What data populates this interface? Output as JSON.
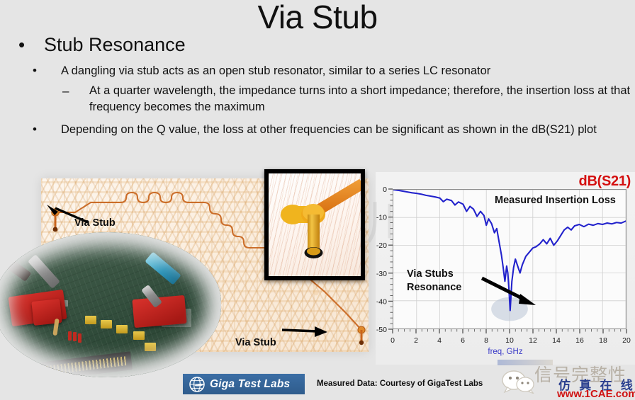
{
  "slide": {
    "title": "Via Stub",
    "background_color": "#e5e5e5"
  },
  "bullets": {
    "level1": "Stub Resonance",
    "level1_marker": "•",
    "items": [
      {
        "marker": "•",
        "level": 2,
        "text": "A dangling via stub acts as an open stub resonator, similar to a series LC resonator"
      },
      {
        "marker": "–",
        "level": 3,
        "text": "At a quarter wavelength, the impedance turns into a short impedance; therefore, the insertion loss at that frequency becomes the maximum"
      },
      {
        "marker": "•",
        "level": 2,
        "text": "Depending on the Q value, the loss at other frequencies can be significant as shown in the dB(S21) plot"
      }
    ]
  },
  "figures": {
    "pcb_callout_1": "Via Stub",
    "pcb_callout_2": "Via Stub",
    "via3d_caption": ""
  },
  "footer": {
    "logo_text": "Giga Test Labs",
    "logo_icon": "globe-icon",
    "courtesy": "Measured Data: Courtesy of GigaTest Labs"
  },
  "watermark": {
    "icon": "wechat-icon",
    "line1": "信号完整性",
    "line2": "仿 真 在 线",
    "url": "www.1CAE.com"
  },
  "chart_data": {
    "type": "line",
    "title": "dB(S21)",
    "title_color": "#d41010",
    "annotation": "Measured Insertion Loss",
    "callout": "Via Stubs\nResonance",
    "callout_line1": "Via Stubs",
    "callout_line2": "Resonance",
    "xlabel": "freq, GHz",
    "ylabel": "",
    "xlim": [
      0,
      20
    ],
    "ylim": [
      -50,
      0
    ],
    "xticks": [
      0,
      2,
      4,
      6,
      8,
      10,
      12,
      14,
      16,
      18,
      20
    ],
    "yticks": [
      0,
      -10,
      -20,
      -30,
      -40,
      -50
    ],
    "grid": true,
    "legend": "none",
    "series": [
      {
        "name": "dB(S21)",
        "color": "#2222cc",
        "x": [
          0.0,
          0.4,
          0.8,
          1.2,
          1.6,
          2.0,
          2.4,
          2.8,
          3.2,
          3.6,
          4.0,
          4.3,
          4.6,
          5.0,
          5.3,
          5.6,
          6.0,
          6.3,
          6.6,
          6.9,
          7.2,
          7.5,
          7.8,
          8.0,
          8.2,
          8.45,
          8.7,
          8.9,
          9.1,
          9.3,
          9.45,
          9.6,
          9.75,
          9.85,
          9.95,
          10.05,
          10.2,
          10.35,
          10.5,
          10.7,
          10.9,
          11.1,
          11.4,
          11.7,
          12.0,
          12.3,
          12.6,
          12.9,
          13.2,
          13.5,
          13.8,
          14.1,
          14.4,
          14.7,
          15.0,
          15.3,
          15.6,
          16.0,
          16.4,
          16.8,
          17.2,
          17.6,
          18.0,
          18.4,
          18.8,
          19.2,
          19.6,
          20.0
        ],
        "y": [
          0.0,
          -0.2,
          -0.5,
          -0.8,
          -1.1,
          -1.3,
          -1.6,
          -2.0,
          -2.3,
          -2.6,
          -3.0,
          -4.3,
          -3.4,
          -3.9,
          -5.5,
          -4.4,
          -5.2,
          -7.8,
          -6.0,
          -7.0,
          -9.6,
          -7.8,
          -9.3,
          -12.8,
          -10.5,
          -12.2,
          -15.5,
          -14.0,
          -18.8,
          -23.5,
          -28.0,
          -33.0,
          -27.5,
          -30.0,
          -36.0,
          -43.5,
          -33.0,
          -28.0,
          -25.0,
          -27.5,
          -30.0,
          -27.0,
          -24.0,
          -22.5,
          -21.0,
          -20.5,
          -19.5,
          -18.0,
          -19.5,
          -17.5,
          -20.0,
          -18.5,
          -16.5,
          -14.5,
          -13.5,
          -14.5,
          -13.0,
          -12.5,
          -13.3,
          -12.4,
          -12.8,
          -12.2,
          -12.5,
          -12.0,
          -12.3,
          -11.8,
          -12.0,
          -11.3
        ]
      }
    ]
  }
}
